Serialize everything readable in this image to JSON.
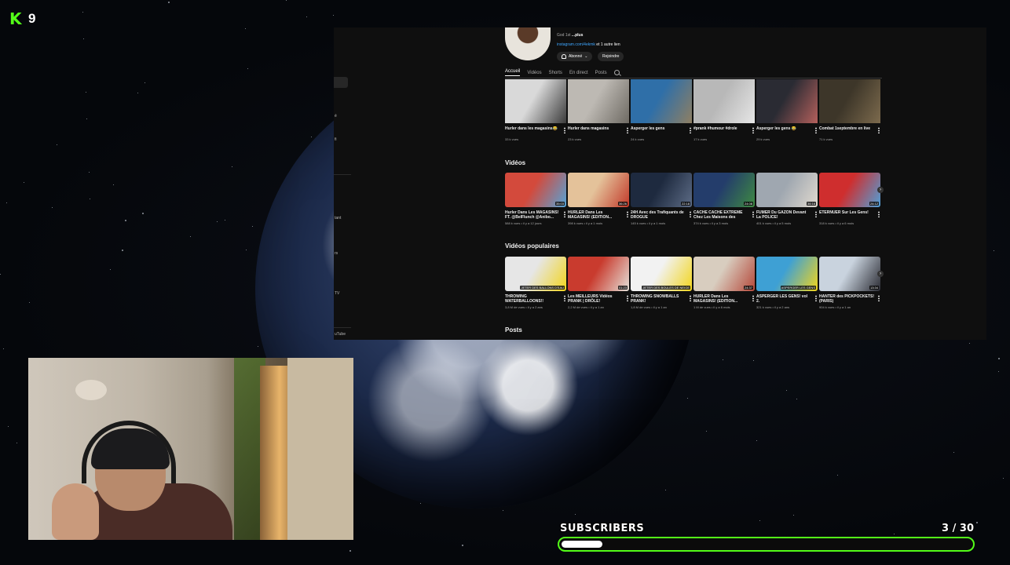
{
  "overlay": {
    "logo_letter": "K",
    "viewer_count": "9",
    "goal_label": "SUBSCRIBERS",
    "goal_current": "3",
    "goal_target": "30",
    "goal_separator": "/",
    "goal_progress_fraction": 0.1,
    "accent_color": "#53fc18"
  },
  "youtube": {
    "channel": {
      "description_text": "God 1st",
      "description_more": "...plus",
      "link_text": "instagram.com/4ekmk",
      "link_suffix": "et 1 autre lien",
      "subscribed_label": "Abonné",
      "join_label": "Rejoindre"
    },
    "sidebar_fragments": [
      "é",
      "fi",
      "tant",
      "rs",
      "TV",
      "uTube"
    ],
    "tabs": [
      "Accueil",
      "Vidéos",
      "Shorts",
      "En direct",
      "Posts"
    ],
    "active_tab": "Accueil",
    "shorts": [
      {
        "title": "Hurler dans les magasins😂",
        "meta": "33 k vues",
        "c1": "#d9d9d9",
        "c2": "#3b3b3b"
      },
      {
        "title": "Hurler dans magasins",
        "meta": "23 k vues",
        "c1": "#bdb9b3",
        "c2": "#6e6a63"
      },
      {
        "title": "Asperger les gens",
        "meta": "24 k vues",
        "c1": "#2f6fa8",
        "c2": "#8f7f62"
      },
      {
        "title": "#prank #humour #drole",
        "meta": "17 k vues",
        "c1": "#b8b8b8",
        "c2": "#e6e6e6"
      },
      {
        "title": "Asperger les gens 😂",
        "meta": "29 k vues",
        "c1": "#2a2b33",
        "c2": "#b4605c"
      },
      {
        "title": "Combat 1septembre en live",
        "meta": "71 k vues",
        "c1": "#3d3629",
        "c2": "#7c6a4d"
      }
    ],
    "videos_title": "Vidéos",
    "videos": [
      {
        "title": "Hurler Dans Les MAGASINS! FT. @BelFlunch @Anibo...",
        "meta": "588 k vues • il y a 12 jours",
        "dur": "35:03",
        "c1": "#d34a3c",
        "c2": "#55a4d8"
      },
      {
        "title": "HURLER Dans Les MAGASINS! (EDITION...",
        "meta": "398 k vues • il y a 1 mois",
        "dur": "36:26",
        "c1": "#e4c29a",
        "c2": "#c23a2a"
      },
      {
        "title": "24H Avec des Trafiquants de DROGUE",
        "meta": "145 k vues • il y a 1 mois",
        "dur": "22:18",
        "c1": "#1e2a3f",
        "c2": "#5d6c86"
      },
      {
        "title": "CACHE CACHE EXTREME Chez Les Maisons des GENS!",
        "meta": "374 k vues • il y a 3 mois",
        "dur": "24:08",
        "c1": "#243d6b",
        "c2": "#3e8a42"
      },
      {
        "title": "FUMER Du GAZON Devant La POLICE!",
        "meta": "401 k vues • il y a 5 mois",
        "dur": "36:16",
        "c1": "#9fa7b0",
        "c2": "#e0d9cf"
      },
      {
        "title": "ÉTERNUER Sur Les Gens!",
        "meta": "318 k vues • il y a 6 mois",
        "dur": "24:12",
        "c1": "#cf2e2e",
        "c2": "#4fa0d8"
      }
    ],
    "popular_title": "Vidéos populaires",
    "popular": [
      {
        "title": "THROWING WATERBALLOONS!!",
        "meta": "3,8 M de vues • il y a 2 ans",
        "dur": "JETER DES BALLONS D'EAU",
        "c1": "#e6e6e6",
        "c2": "#f2d51c"
      },
      {
        "title": "Les MEILLEURS Vidéos PRANK | DRÔLE!",
        "meta": "2,2 M de vues • il y a 1 an",
        "dur": "01:23",
        "c1": "#c93b2e",
        "c2": "#e4e0d8"
      },
      {
        "title": "THROWING SNOWBALLS PRANK!",
        "meta": "1,8 M de vues • il y a 1 an",
        "dur": "JETER DES BOULES DE NEIGE",
        "c1": "#f2f2f2",
        "c2": "#f2d51c"
      },
      {
        "title": "HURLER Dans Les MAGASINS! (EDITION...",
        "meta": "1 M de vues • il y a 6 mois",
        "dur": "24:37",
        "c1": "#d8cdbf",
        "c2": "#b5483a"
      },
      {
        "title": "ASPERGER LES GENS! vol 2.",
        "meta": "321 k vues • il y a 2 ans",
        "dur": "ASPERGER LES GENS",
        "c1": "#3ea0d4",
        "c2": "#f2d51c"
      },
      {
        "title": "HANTER des PICKPOCKETS! (PARIS)",
        "meta": "904 k vues • il y a 1 an",
        "dur": "13:34",
        "c1": "#c9d3de",
        "c2": "#2a2b33"
      }
    ],
    "posts_title": "Posts"
  }
}
